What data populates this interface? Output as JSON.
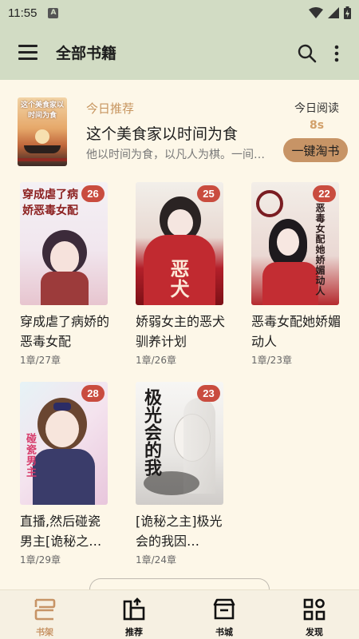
{
  "status_bar": {
    "time": "11:55",
    "notification_letter": "A"
  },
  "app_bar": {
    "title": "全部书籍"
  },
  "today_recommend": {
    "label": "今日推荐",
    "book_title": "这个美食家以时间为食",
    "intro": "他以时间为食，以凡人为棋。一间…",
    "cover_text": "这个美食家以时间为食",
    "reading_label": "今日阅读",
    "reading_time": "8s",
    "button_label": "一键淘书"
  },
  "books": [
    {
      "title": "穿成虐了病娇的恶毒女配",
      "progress": "1章/27章",
      "unread": "26",
      "cover_text": "穿成虐了病娇恶毒女配"
    },
    {
      "title": "娇弱女主的恶犬驯养计划",
      "progress": "1章/26章",
      "unread": "25",
      "cover_text": "恶犬"
    },
    {
      "title": "恶毒女配她娇媚动人",
      "progress": "1章/23章",
      "unread": "22",
      "cover_text": "恶毒女配她娇媚动人"
    },
    {
      "title": "直播,然后碰瓷男主[诡秘之…",
      "progress": "1章/29章",
      "unread": "28",
      "cover_text": "碰瓷男主"
    },
    {
      "title": "[诡秘之主]极光会的我因…",
      "progress": "1章/24章",
      "unread": "23",
      "cover_text": "极光会的我"
    }
  ],
  "bottom_nav": [
    {
      "label": "书架",
      "icon": "bookshelf-icon",
      "active": true
    },
    {
      "label": "推荐",
      "icon": "recommend-icon",
      "active": false
    },
    {
      "label": "书城",
      "icon": "bookstore-icon",
      "active": false
    },
    {
      "label": "发现",
      "icon": "discover-icon",
      "active": false
    }
  ],
  "colors": {
    "header_bg": "#d2dcc4",
    "page_bg": "#fdf7e8",
    "accent": "#c79466",
    "badge": "#c94c3f"
  }
}
